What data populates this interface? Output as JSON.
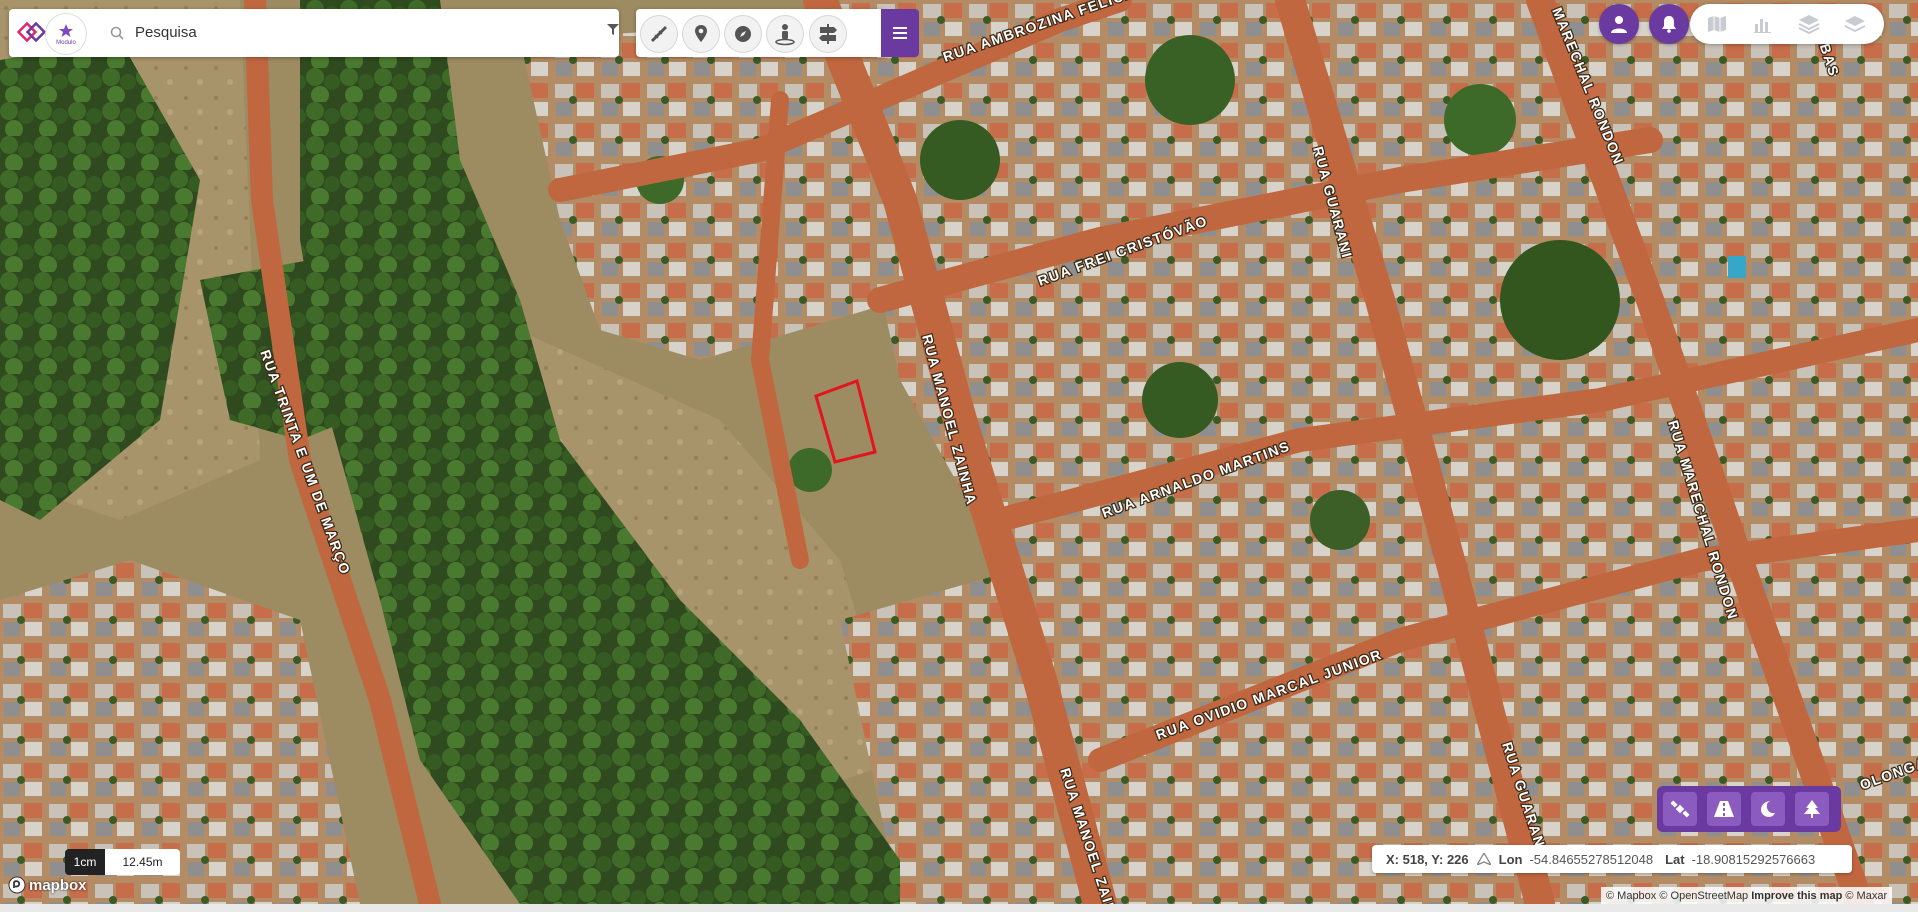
{
  "search": {
    "placeholder": "Pesquisa",
    "logo_text": "Modulo"
  },
  "toolbar": {
    "tools": [
      "measure-icon",
      "pin-icon",
      "compass-icon",
      "person-pin-icon",
      "signpost-icon"
    ],
    "menu": "menu-icon"
  },
  "top_right": {
    "buttons": [
      "user-icon",
      "bell-icon"
    ],
    "layers": [
      "map-icon",
      "bar-chart-icon",
      "layers-3d-icon",
      "stack-icon"
    ]
  },
  "map": {
    "streets": [
      "RUA AMBROZINA FELICAR",
      "RUA GUARANI",
      "MARECHAL RONDON",
      "AMBAS",
      "RUA FREI CRISTÓVÃO",
      "RUA MANOEL ZAINHA",
      "RUA ARNALDO MARTINS",
      "RUA MARECHAL RONDON",
      "RUA TRINTA E UM DE MARÇO",
      "RUA OVIDIO MARCAL JUNIOR",
      "RUA MANOEL ZAINH",
      "RUA GUARAN",
      "OLONGA"
    ]
  },
  "coords": {
    "xy": "X: 518, Y: 226",
    "lon_label": "Lon",
    "lon": "-54.84655278512048",
    "lat_label": "Lat",
    "lat": "-18.90815292576663"
  },
  "scale": {
    "left": "1cm",
    "right": "12.45m"
  },
  "attribution": {
    "mapbox": "© Mapbox",
    "osm": "© OpenStreetMap",
    "improve": "Improve this map",
    "maxar": "© Maxar"
  },
  "mapbox_logo": "mapbox",
  "colors": {
    "accent": "#6b3aa0",
    "parcel_outline": "#e4141b"
  }
}
